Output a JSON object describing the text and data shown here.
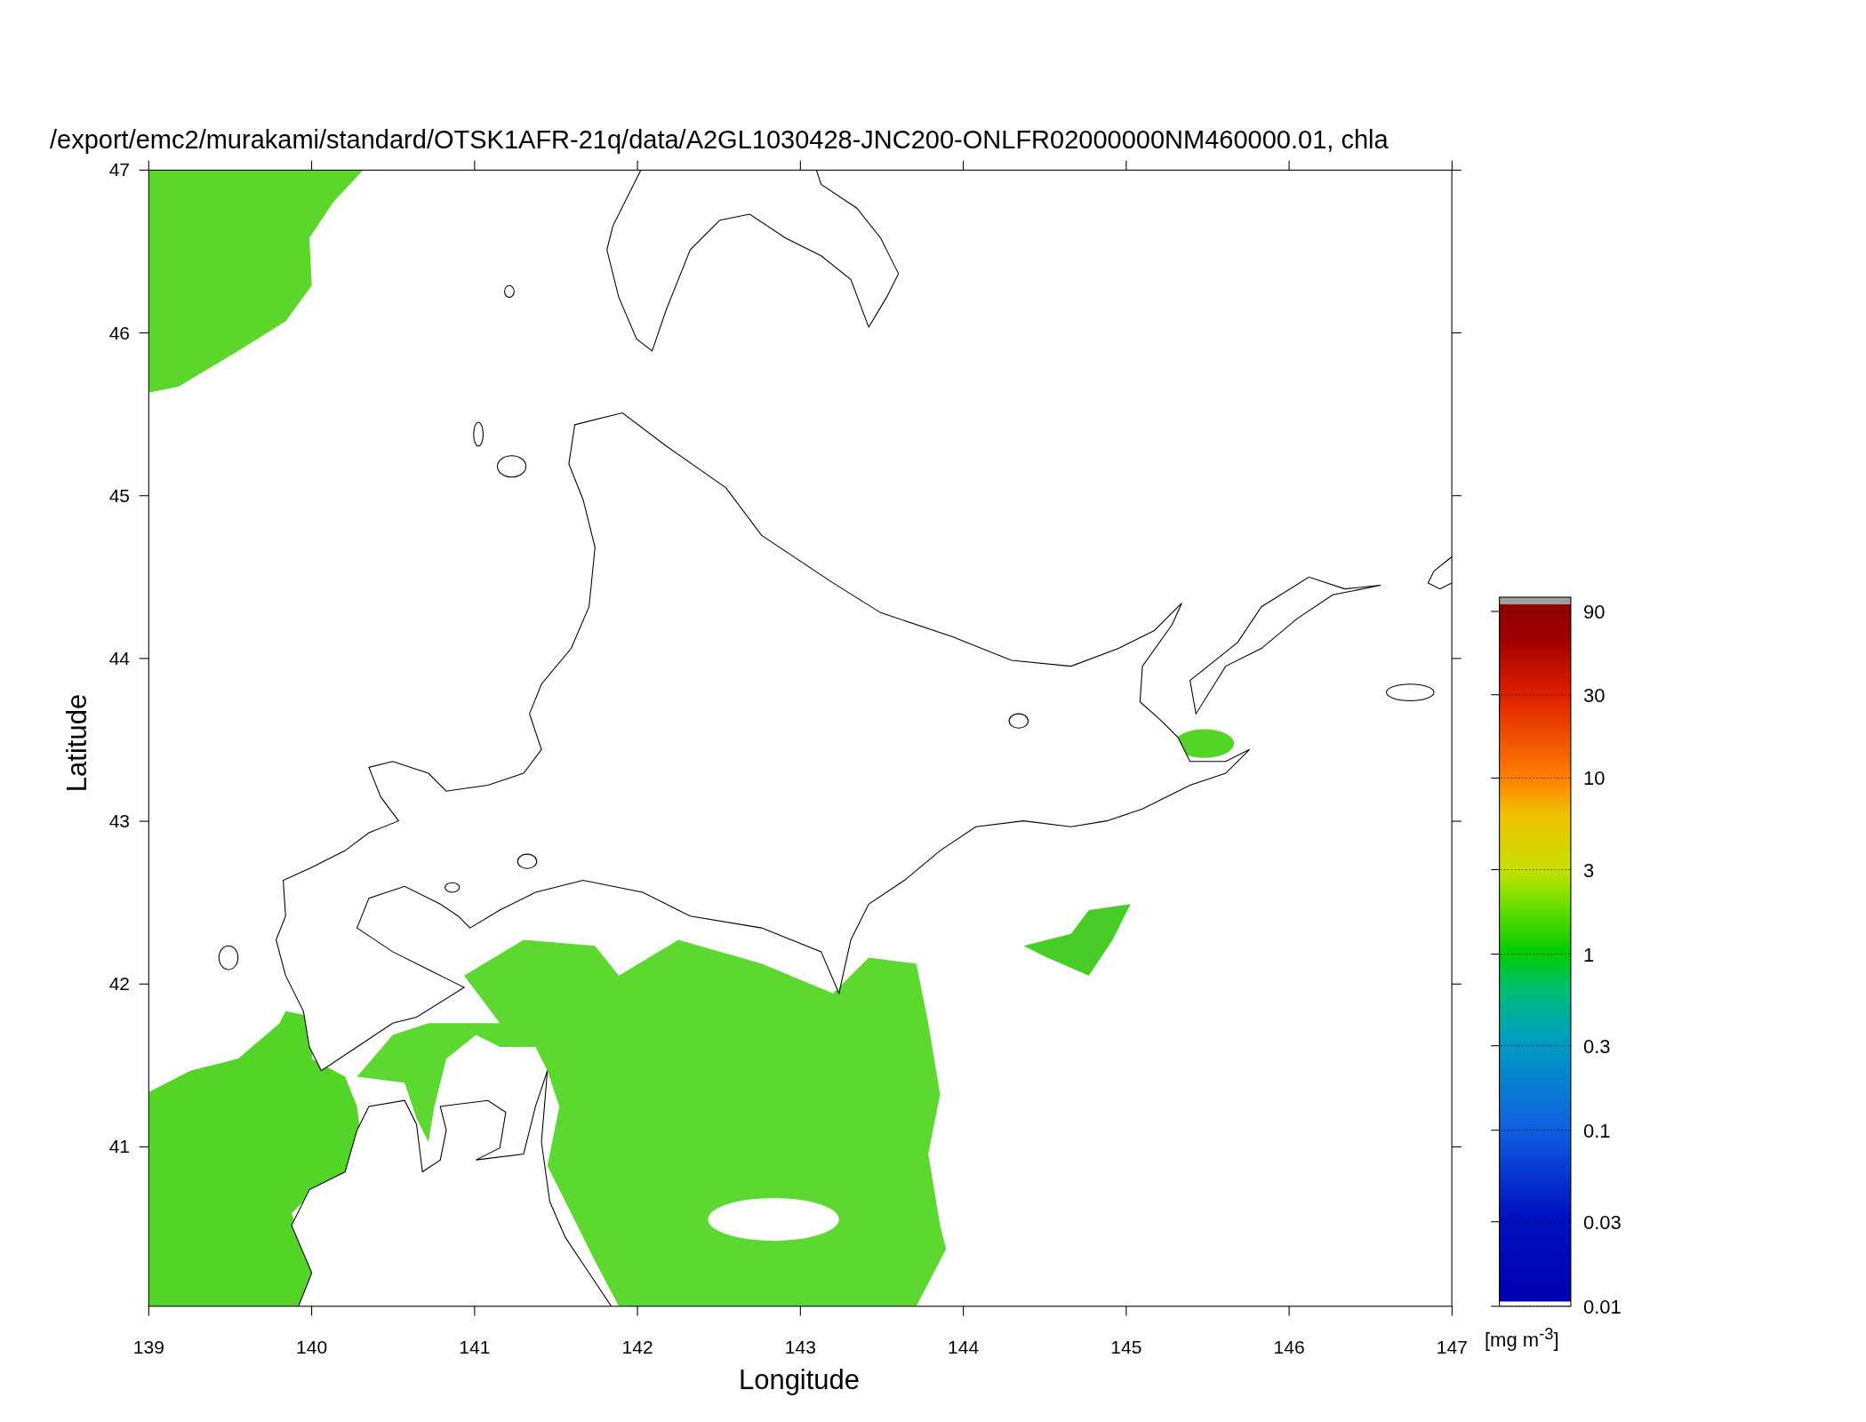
{
  "title": "/export/emc2/murakami/standard/OTSK1AFR-21q/data/A2GL1030428-JNC200-ONLFR02000000NM460000.01, chla",
  "x_axis": {
    "label": "Longitude",
    "ticks": [
      "139",
      "140",
      "141",
      "142",
      "143",
      "144",
      "145",
      "146",
      "147"
    ]
  },
  "y_axis": {
    "label": "Latitude",
    "ticks": [
      "47",
      "46",
      "45",
      "44",
      "43",
      "42",
      "41"
    ]
  },
  "colorbar": {
    "ticks": [
      "90",
      "30",
      "10",
      "3",
      "1",
      "0.3",
      "0.1",
      "0.03",
      "0.01"
    ],
    "unit": "[mg m$^{-3}$]"
  }
}
